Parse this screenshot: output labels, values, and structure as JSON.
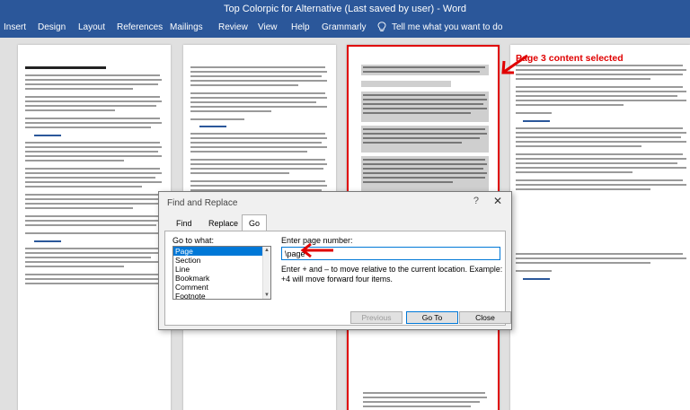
{
  "window": {
    "title": "Top Colorpic for Alternative (Last saved by user) - Word"
  },
  "ribbon": {
    "tabs": [
      "Insert",
      "Design",
      "Layout",
      "References",
      "Mailings",
      "Review",
      "View",
      "Help",
      "Grammarly"
    ],
    "tell_me": "Tell me what you want to do"
  },
  "annotation": {
    "text": "Page 3 content selected"
  },
  "dialog": {
    "title": "Find and Replace",
    "help_glyph": "?",
    "close_glyph": "✕",
    "tabs": [
      "Find",
      "Replace",
      "Go To"
    ],
    "active_tab": "Go To",
    "goto_label": "Go to what:",
    "goto_items": [
      "Page",
      "Section",
      "Line",
      "Bookmark",
      "Comment",
      "Footnote"
    ],
    "selected_item": "Page",
    "enter_label": "Enter page number:",
    "input_value": "\\page",
    "help_text": "Enter + and – to move relative to the current location. Example: +4 will move forward four items.",
    "buttons": {
      "previous": "Previous",
      "goto": "Go To",
      "close": "Close"
    }
  },
  "colors": {
    "accent": "#2b579a",
    "highlight": "#e00000",
    "selection": "#0078d7"
  },
  "icons": {
    "tell_me": "lightbulb-icon",
    "annotation_arrow": "red-arrow-icon"
  }
}
